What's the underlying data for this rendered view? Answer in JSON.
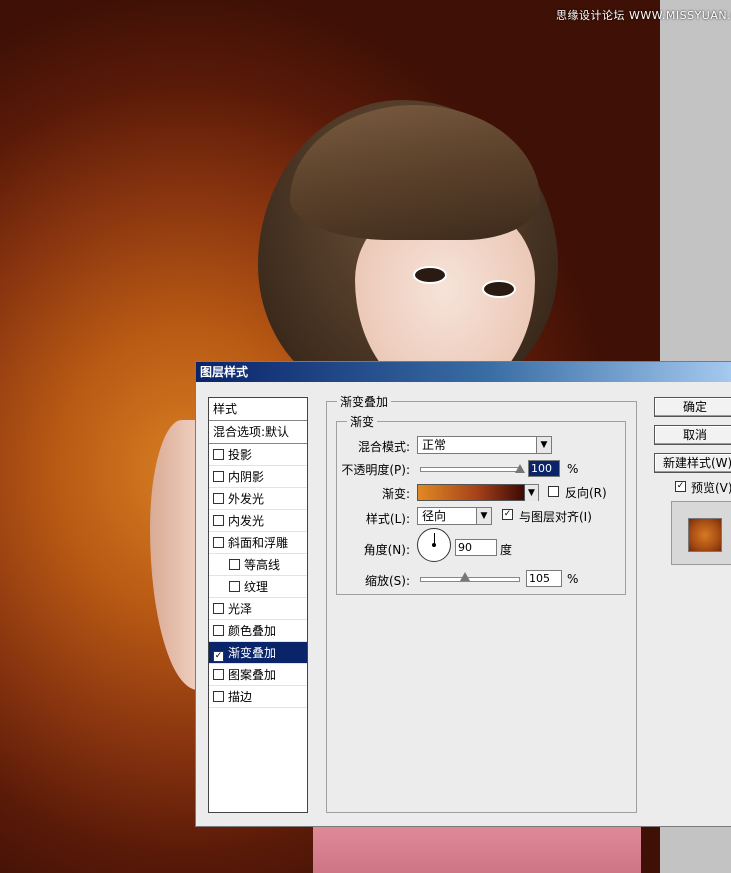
{
  "watermark": "思缘设计论坛 WWW.MISSYUAN.COM",
  "dialog": {
    "title": "图层样式",
    "sidebar": {
      "header": "样式",
      "blend_default": "混合选项:默认",
      "items": [
        {
          "label": "投影",
          "checked": false,
          "sub": false
        },
        {
          "label": "内阴影",
          "checked": false,
          "sub": false
        },
        {
          "label": "外发光",
          "checked": false,
          "sub": false
        },
        {
          "label": "内发光",
          "checked": false,
          "sub": false
        },
        {
          "label": "斜面和浮雕",
          "checked": false,
          "sub": false
        },
        {
          "label": "等高线",
          "checked": false,
          "sub": true
        },
        {
          "label": "纹理",
          "checked": false,
          "sub": true
        },
        {
          "label": "光泽",
          "checked": false,
          "sub": false
        },
        {
          "label": "颜色叠加",
          "checked": false,
          "sub": false
        },
        {
          "label": "渐变叠加",
          "checked": true,
          "sub": false,
          "selected": true
        },
        {
          "label": "图案叠加",
          "checked": false,
          "sub": false
        },
        {
          "label": "描边",
          "checked": false,
          "sub": false
        }
      ]
    },
    "panel": {
      "group_title": "渐变叠加",
      "sub_group_title": "渐变",
      "blend_mode_label": "混合模式:",
      "blend_mode_value": "正常",
      "opacity_label": "不透明度(P):",
      "opacity_value": "100",
      "opacity_unit": "%",
      "opacity_level": 100,
      "gradient_label": "渐变:",
      "reverse_label": "反向(R)",
      "reverse_checked": false,
      "style_label": "样式(L):",
      "style_value": "径向",
      "align_label": "与图层对齐(I)",
      "align_checked": true,
      "angle_label": "角度(N):",
      "angle_value": "90",
      "angle_unit": "度",
      "scale_label": "缩放(S):",
      "scale_value": "105",
      "scale_unit": "%",
      "scale_level_percent": 105,
      "gradient_colors": [
        "#e08a22",
        "#a8421a",
        "#3c0a05"
      ]
    },
    "buttons": {
      "ok": "确定",
      "cancel": "取消",
      "new_style": "新建样式(W)...",
      "preview_label": "预览(V)",
      "preview_checked": true
    }
  }
}
